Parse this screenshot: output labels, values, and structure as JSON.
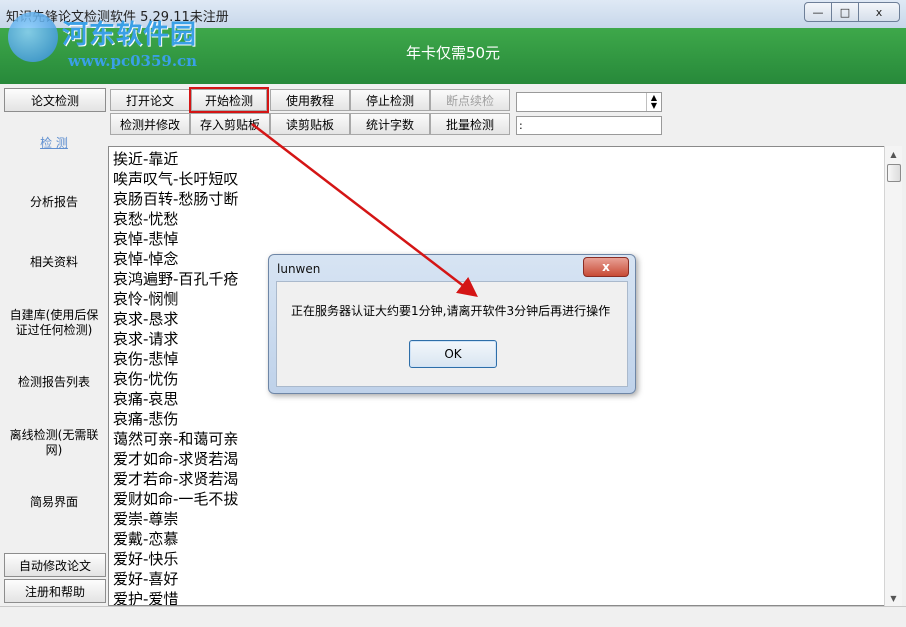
{
  "window": {
    "title": "知识先锋论文检测软件 5.29.11未注册",
    "buttons": [
      "—",
      "□",
      "x"
    ]
  },
  "watermark": {
    "name": "河东软件园",
    "url": "www.pc0359.cn"
  },
  "banner": {
    "ad_text": "年卡仅需50元"
  },
  "nav": {
    "top_button": "论文检测",
    "links": [
      {
        "label": "检 测",
        "active": true
      },
      {
        "label": "分析报告"
      },
      {
        "label": "相关资料"
      },
      {
        "label": "自建库(使用后保证过任何检测)"
      },
      {
        "label": "检测报告列表"
      },
      {
        "label": "离线检测(无需联网)"
      },
      {
        "label": "简易界面"
      }
    ],
    "bottom_buttons": [
      "自动修改论文",
      "注册和帮助"
    ]
  },
  "toolbar": {
    "row1": [
      "打开论文",
      "开始检测",
      "使用教程",
      "停止检测",
      "断点续检"
    ],
    "row2": [
      "检测并修改",
      "存入剪贴板",
      "读剪贴板",
      "统计字数",
      "批量检测"
    ],
    "combo_value": "",
    "field_value": ":"
  },
  "content": {
    "lines": [
      "挨近-靠近",
      "唉声叹气-长吁短叹",
      "哀肠百转-愁肠寸断",
      "哀愁-忧愁",
      "哀悼-悲悼",
      "哀悼-悼念",
      "哀鸿遍野-百孔千疮",
      "哀怜-悯恻",
      "哀求-恳求",
      "哀求-请求",
      "哀伤-悲悼",
      "哀伤-忧伤",
      "哀痛-哀思",
      "哀痛-悲伤",
      "蔼然可亲-和蔼可亲",
      "爱才如命-求贤若渴",
      "爱才若命-求贤若渴",
      "爱财如命-一毛不拔",
      "爱崇-尊崇",
      "爱戴-恋慕",
      "爱好-快乐",
      "爱好-喜好",
      "爱护-爱惜"
    ]
  },
  "dialog": {
    "title": "lunwen",
    "close_label": "x",
    "message": "正在服务器认证大约要1分钟,请离开软件3分钟后再进行操作",
    "ok_label": "OK"
  },
  "colors": {
    "banner": "#2e9a40",
    "annotation": "#d41515",
    "active_link": "#5f8fd0"
  }
}
